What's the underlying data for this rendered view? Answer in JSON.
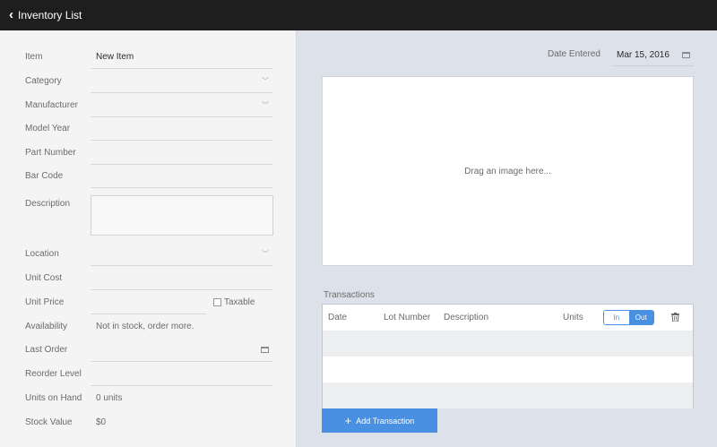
{
  "header": {
    "back_label": "Inventory List"
  },
  "form": {
    "item": {
      "label": "Item",
      "value": "New Item"
    },
    "category": {
      "label": "Category",
      "value": ""
    },
    "manufacturer": {
      "label": "Manufacturer",
      "value": ""
    },
    "model_year": {
      "label": "Model Year",
      "value": ""
    },
    "part_number": {
      "label": "Part Number",
      "value": ""
    },
    "bar_code": {
      "label": "Bar Code",
      "value": ""
    },
    "description": {
      "label": "Description",
      "value": ""
    },
    "location": {
      "label": "Location",
      "value": ""
    },
    "unit_cost": {
      "label": "Unit Cost",
      "value": ""
    },
    "unit_price": {
      "label": "Unit Price",
      "value": ""
    },
    "taxable": {
      "label": "Taxable",
      "checked": false
    },
    "availability": {
      "label": "Availability",
      "value": "Not in stock, order more."
    },
    "last_order": {
      "label": "Last Order",
      "value": ""
    },
    "reorder_level": {
      "label": "Reorder Level",
      "value": ""
    },
    "units_on_hand": {
      "label": "Units on Hand",
      "value": "0 units"
    },
    "stock_value": {
      "label": "Stock Value",
      "value": "$0"
    }
  },
  "right": {
    "date_entered_label": "Date Entered",
    "date_entered_value": "Mar 15, 2016",
    "image_dropzone_text": "Drag an image here...",
    "transactions_title": "Transactions",
    "columns": {
      "date": "Date",
      "lot_number": "Lot Number",
      "description": "Description",
      "units": "Units"
    },
    "toggle": {
      "in_label": "In",
      "out_label": "Out",
      "selected": "Out"
    },
    "add_button_label": "Add Transaction"
  },
  "colors": {
    "accent": "#4a90e2",
    "titlebar": "#1e1e1e",
    "left_bg": "#f4f4f4",
    "right_bg": "#dde2ea"
  },
  "icons": {
    "back": "chevron-left-icon",
    "dropdown": "chevron-down-icon",
    "calendar": "calendar-icon",
    "trash": "trash-icon",
    "add": "plus-icon"
  }
}
